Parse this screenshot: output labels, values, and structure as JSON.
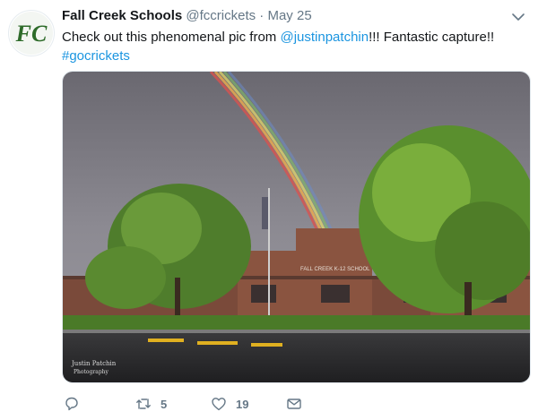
{
  "account": {
    "name": "Fall Creek Schools",
    "handle": "@fccrickets",
    "separator": "·",
    "date": "May 25",
    "avatar_initials": "FC"
  },
  "tweet": {
    "text_before": "Check out this phenomenal pic from ",
    "mention": "@justinpatchin",
    "text_after": "!!! Fantastic capture!!",
    "hashtag": "#gocrickets"
  },
  "photo": {
    "alt": "Rainbow over Fall Creek K-12 School",
    "building_sign": "FALL CREEK K-12 SCHOOL",
    "watermark_line1": "Justin Patchin",
    "watermark_line2": "Photography"
  },
  "actions": {
    "reply_count": "",
    "retweet_count": "5",
    "like_count": "19"
  },
  "colors": {
    "link": "#1b95e0",
    "secondary_text": "#657786",
    "icon": "#657786",
    "avatar_green": "#2e6b2a"
  },
  "icons": [
    "chevron-down-icon",
    "reply-icon",
    "retweet-icon",
    "like-icon",
    "message-icon"
  ]
}
